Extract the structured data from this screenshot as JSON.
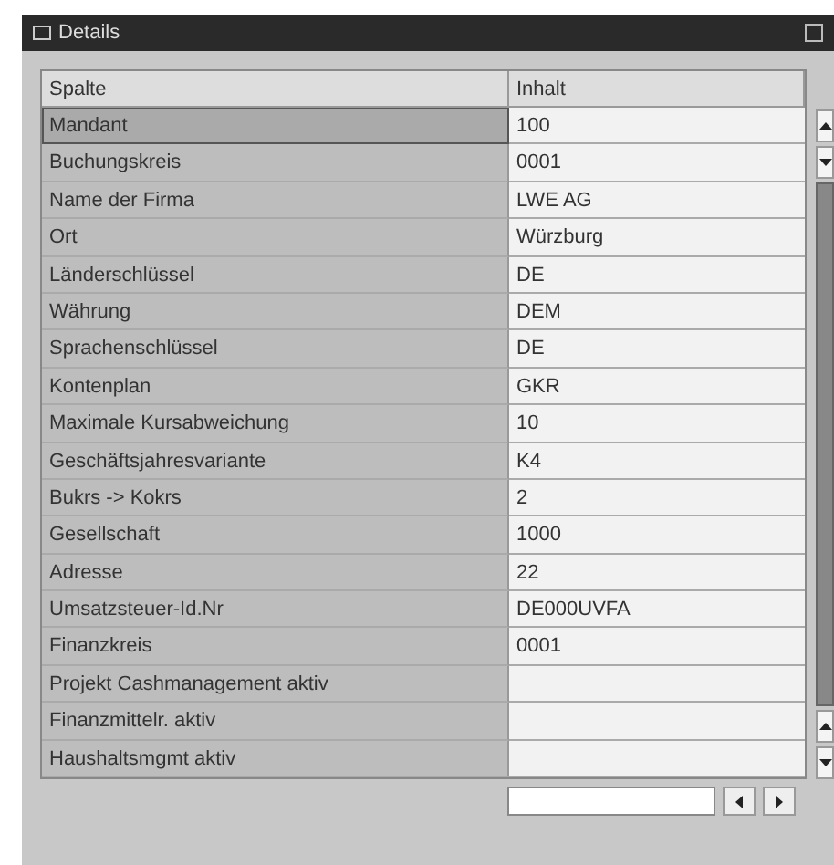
{
  "window": {
    "title": "Details"
  },
  "table": {
    "columns": [
      "Spalte",
      "Inhalt"
    ],
    "rows": [
      {
        "label": "Mandant",
        "value": "100",
        "selected": true
      },
      {
        "label": "Buchungskreis",
        "value": "0001",
        "selected": false
      },
      {
        "label": "Name der Firma",
        "value": "LWE AG",
        "selected": false
      },
      {
        "label": "Ort",
        "value": "Würzburg",
        "selected": false
      },
      {
        "label": "Länderschlüssel",
        "value": "DE",
        "selected": false
      },
      {
        "label": "Währung",
        "value": "DEM",
        "selected": false
      },
      {
        "label": "Sprachenschlüssel",
        "value": "DE",
        "selected": false
      },
      {
        "label": "Kontenplan",
        "value": "GKR",
        "selected": false
      },
      {
        "label": "Maximale Kursabweichung",
        "value": "10",
        "selected": false
      },
      {
        "label": "Geschäftsjahresvariante",
        "value": "K4",
        "selected": false
      },
      {
        "label": "Bukrs -> Kokrs",
        "value": "2",
        "selected": false
      },
      {
        "label": "Gesellschaft",
        "value": "1000",
        "selected": false
      },
      {
        "label": "Adresse",
        "value": "22",
        "selected": false
      },
      {
        "label": "Umsatzsteuer-Id.Nr",
        "value": "DE000UVFA",
        "selected": false
      },
      {
        "label": "Finanzkreis",
        "value": "0001",
        "selected": false
      },
      {
        "label": "Projekt Cashmanagement aktiv",
        "value": "",
        "selected": false
      },
      {
        "label": "Finanzmittelr. aktiv",
        "value": "",
        "selected": false
      },
      {
        "label": "Haushaltsmgmt aktiv",
        "value": "",
        "selected": false
      }
    ]
  }
}
